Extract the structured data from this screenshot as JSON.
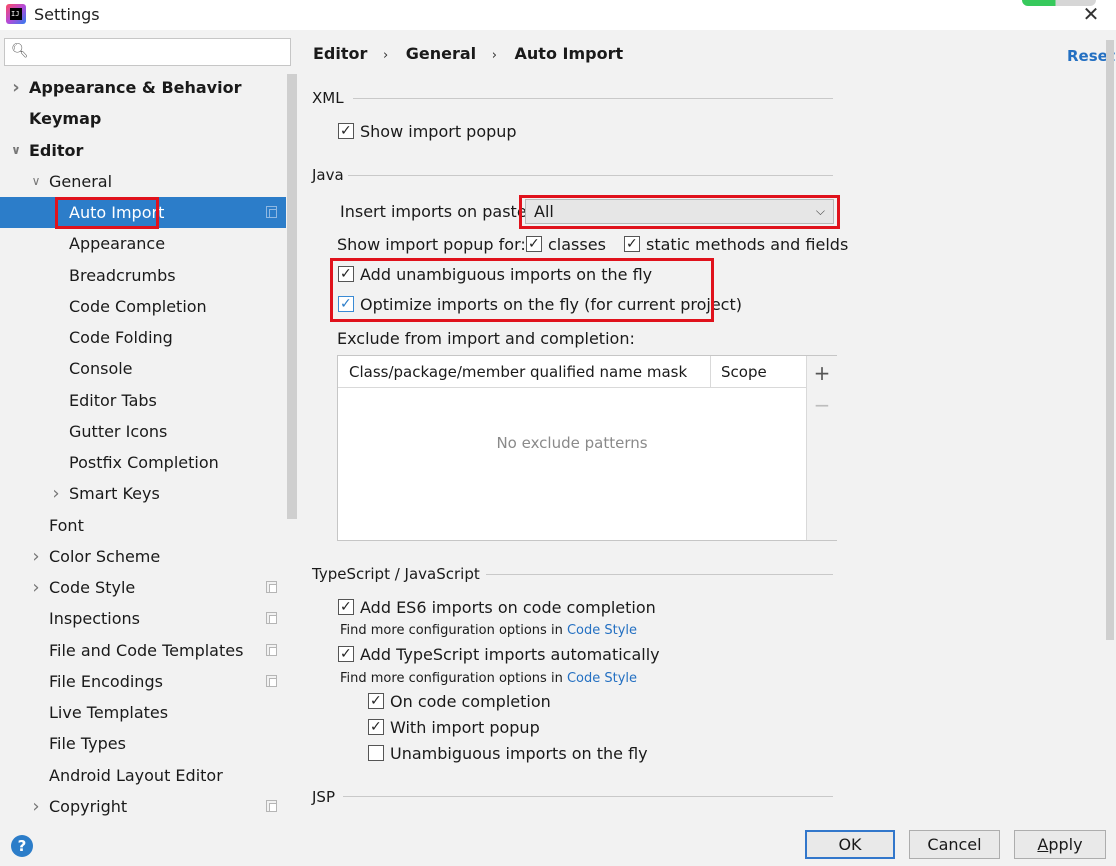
{
  "window": {
    "title": "Settings"
  },
  "search": {
    "placeholder": "",
    "value": ""
  },
  "sidebar": {
    "items": [
      {
        "label": "Appearance & Behavior",
        "bold": true,
        "arrow": "right"
      },
      {
        "label": "Keymap",
        "bold": true
      },
      {
        "label": "Editor",
        "bold": true,
        "arrow": "down"
      },
      {
        "label": "General",
        "arrow": "down"
      },
      {
        "label": "Auto Import",
        "selected": true,
        "copy": true
      },
      {
        "label": "Appearance"
      },
      {
        "label": "Breadcrumbs"
      },
      {
        "label": "Code Completion"
      },
      {
        "label": "Code Folding"
      },
      {
        "label": "Console"
      },
      {
        "label": "Editor Tabs"
      },
      {
        "label": "Gutter Icons"
      },
      {
        "label": "Postfix Completion"
      },
      {
        "label": "Smart Keys",
        "arrow": "right"
      },
      {
        "label": "Font"
      },
      {
        "label": "Color Scheme",
        "arrow": "right"
      },
      {
        "label": "Code Style",
        "arrow": "right",
        "copy": true
      },
      {
        "label": "Inspections",
        "copy": true
      },
      {
        "label": "File and Code Templates",
        "copy": true
      },
      {
        "label": "File Encodings",
        "copy": true
      },
      {
        "label": "Live Templates"
      },
      {
        "label": "File Types"
      },
      {
        "label": "Android Layout Editor"
      },
      {
        "label": "Copyright",
        "arrow": "right",
        "copy": true
      }
    ]
  },
  "breadcrumb": {
    "items": [
      "Editor",
      "General",
      "Auto Import"
    ],
    "separator": "›"
  },
  "reset_label": "Reset",
  "xml": {
    "title": "XML",
    "show_import_popup": {
      "label": "Show import popup",
      "checked": true
    }
  },
  "java": {
    "title": "Java",
    "insert_imports_label": "Insert imports on paste:",
    "insert_imports_value": "All",
    "show_popup_for_label": "Show import popup for:",
    "classes": {
      "label": "classes",
      "checked": true
    },
    "static_methods": {
      "label": "static methods and fields",
      "checked": true
    },
    "add_unambiguous": {
      "label": "Add unambiguous imports on the fly",
      "checked": true
    },
    "optimize_imports": {
      "label": "Optimize imports on the fly (for current project)",
      "checked": true
    },
    "exclude_label": "Exclude from import and completion:",
    "table": {
      "columns": [
        "Class/package/member qualified name mask",
        "Scope"
      ],
      "empty_text": "No exclude patterns",
      "add_button": "+",
      "remove_button": "−"
    }
  },
  "typescript": {
    "title": "TypeScript / JavaScript",
    "add_es6": {
      "label": "Add ES6 imports on code completion",
      "checked": true
    },
    "hint1_text": "Find more configuration options in ",
    "hint1_link": "Code Style",
    "add_ts": {
      "label": "Add TypeScript imports automatically",
      "checked": true
    },
    "hint2_text": "Find more configuration options in ",
    "hint2_link": "Code Style",
    "on_code_completion": {
      "label": "On code completion",
      "checked": true
    },
    "with_import_popup": {
      "label": "With import popup",
      "checked": true
    },
    "unambiguous_imports": {
      "label": "Unambiguous imports on the fly",
      "checked": false
    }
  },
  "jsp": {
    "title": "JSP"
  },
  "footer": {
    "help_label": "?",
    "ok_label": "OK",
    "cancel_label": "Cancel",
    "apply_label": "Apply"
  },
  "colors": {
    "selection": "#2c7dc9",
    "highlight_box": "#e0121c",
    "link": "#2470c2"
  }
}
